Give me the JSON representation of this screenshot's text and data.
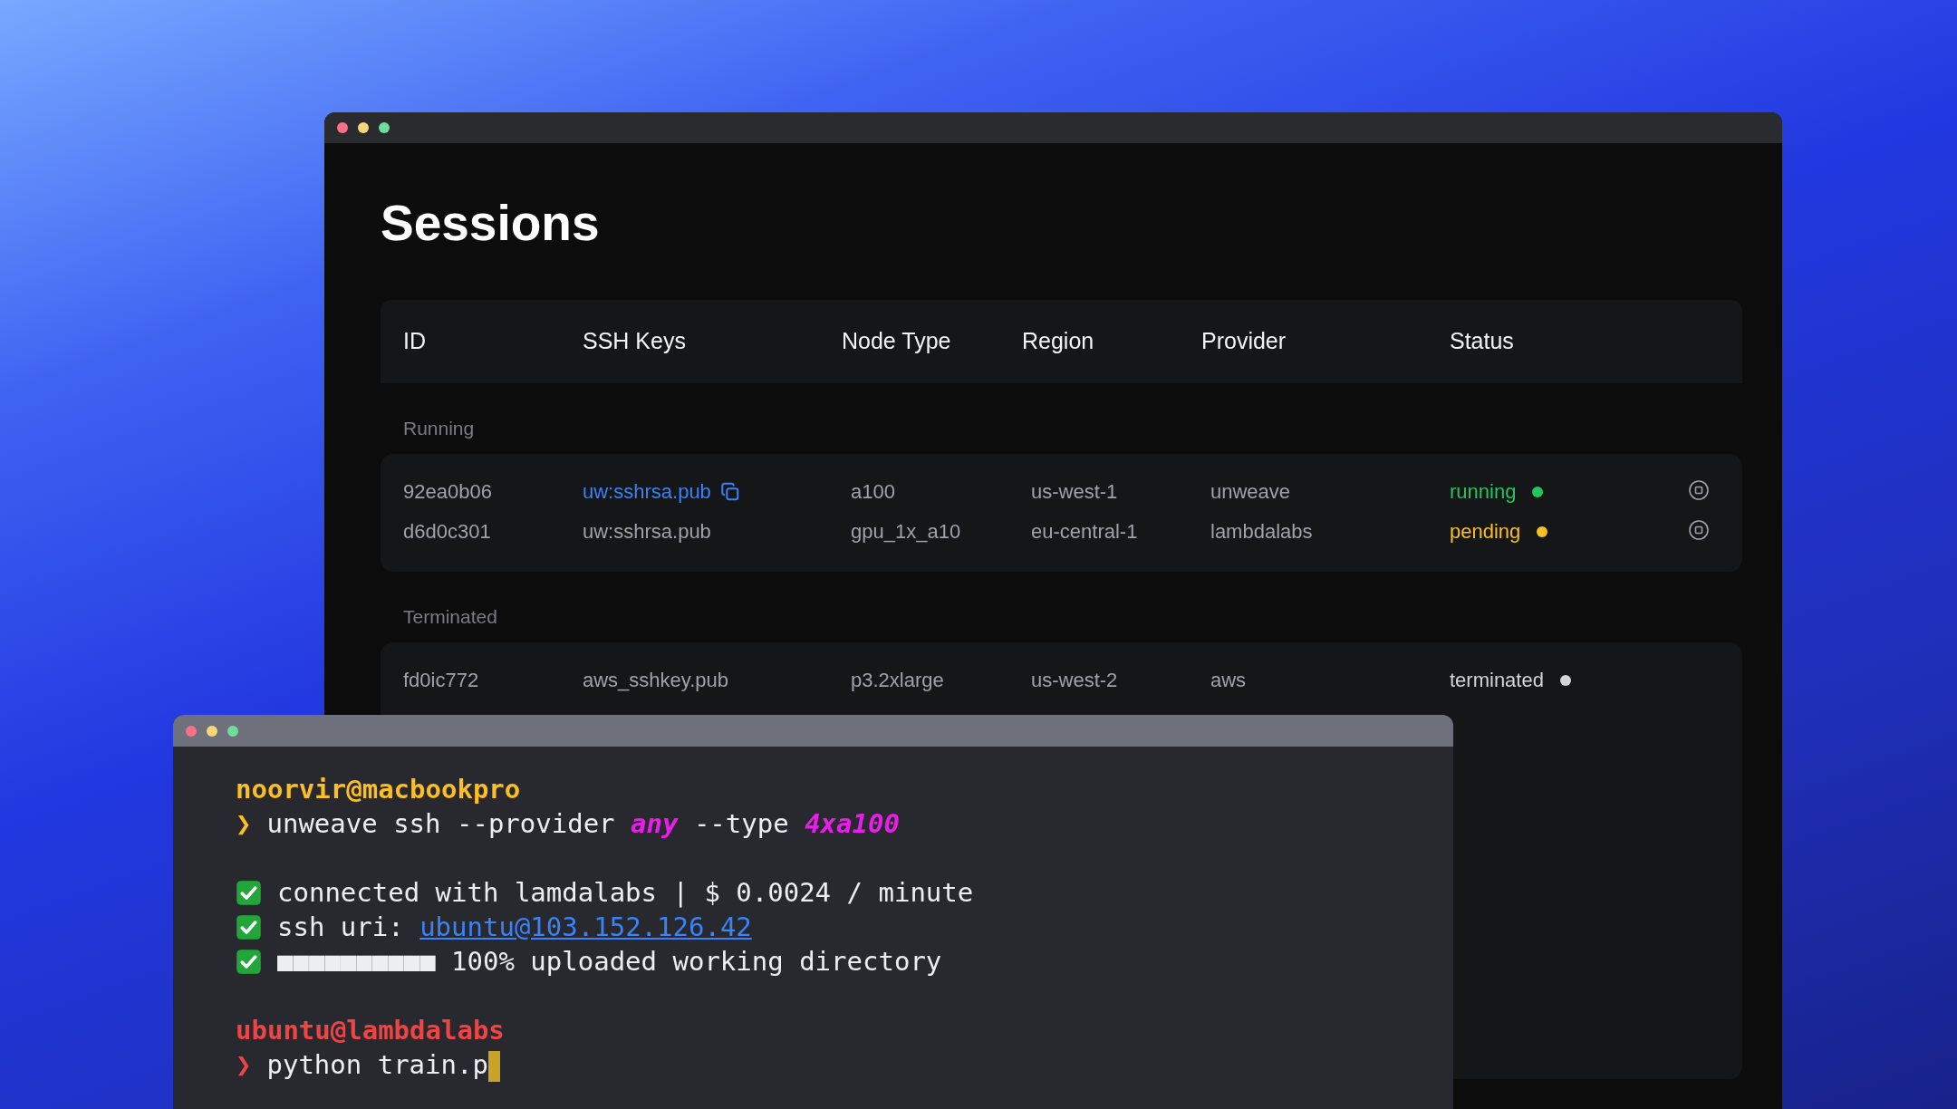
{
  "sessions_window": {
    "title": "Sessions",
    "columns": [
      "ID",
      "SSH Keys",
      "Node Type",
      "Region",
      "Provider",
      "Status"
    ],
    "groups": [
      {
        "label": "Running",
        "rows": [
          {
            "id": "92ea0b06",
            "ssh_key": "uw:sshrsa.pub",
            "key_link": true,
            "node_type": "a100",
            "region": "us-west-1",
            "provider": "unweave",
            "status": "running",
            "color": "#22c55e",
            "stoppable": true
          },
          {
            "id": "d6d0c301",
            "ssh_key": "uw:sshrsa.pub",
            "key_link": false,
            "node_type": "gpu_1x_a10",
            "region": "eu-central-1",
            "provider": "lambdalabs",
            "status": "pending",
            "color": "#fbbf24",
            "stoppable": true
          }
        ]
      },
      {
        "label": "Terminated",
        "rows": [
          {
            "id": "fd0ic772",
            "ssh_key": "aws_sshkey.pub",
            "key_link": false,
            "node_type": "p3.2xlarge",
            "region": "us-west-2",
            "provider": "aws",
            "status": "terminated",
            "color": "#d4d4d8",
            "stoppable": false
          }
        ]
      }
    ]
  },
  "terminal": {
    "lines": [
      {
        "kind": "user",
        "text": "noorvir@macbookpro",
        "color": "#fbbf24"
      },
      {
        "kind": "command",
        "prompt": "❯",
        "color": "#fbbf24",
        "parts": [
          {
            "kind": "plain",
            "text": "unweave ssh --provider"
          },
          {
            "kind": "arg",
            "text": "any"
          },
          {
            "kind": "plain",
            "text": "--type"
          },
          {
            "kind": "arg",
            "text": "4xa100"
          }
        ]
      },
      {
        "kind": "blank"
      },
      {
        "kind": "check",
        "parts": [
          {
            "kind": "plain",
            "text": "connected with lamdalabs | $ 0.0024 / minute"
          }
        ]
      },
      {
        "kind": "check",
        "parts": [
          {
            "kind": "plain",
            "text": "ssh uri:"
          },
          {
            "kind": "link",
            "text": "ubuntu@103.152.126.42"
          }
        ]
      },
      {
        "kind": "check",
        "parts": [
          {
            "kind": "plain",
            "text": "■■■■■■■■■■ 100% uploaded working directory"
          }
        ]
      },
      {
        "kind": "blank"
      },
      {
        "kind": "user",
        "text": "ubuntu@lambdalabs",
        "color": "#ef4444"
      },
      {
        "kind": "command",
        "prompt": "❯",
        "color": "#ef4444",
        "cursor": true,
        "parts": [
          {
            "kind": "plain",
            "text": "python train.p"
          }
        ]
      }
    ]
  }
}
